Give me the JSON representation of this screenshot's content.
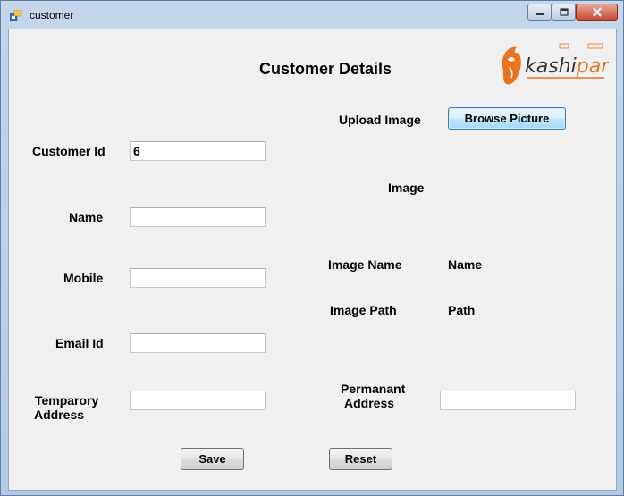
{
  "window": {
    "title": "customer",
    "icon": "form-icon",
    "controls": [
      "minimize-icon",
      "maximize-icon",
      "close-icon"
    ]
  },
  "logo": {
    "text": "kashipara"
  },
  "form": {
    "heading": "Customer Details",
    "customer_id": {
      "label": "Customer Id",
      "value": "6"
    },
    "name": {
      "label": "Name",
      "value": ""
    },
    "mobile": {
      "label": "Mobile",
      "value": ""
    },
    "email": {
      "label": "Email Id",
      "value": ""
    },
    "temporary_address": {
      "label_line1": "Temparory",
      "label_line2": "Address",
      "value": ""
    },
    "permanent_address": {
      "label_line1": "Permanant",
      "label_line2": "Address",
      "value": ""
    },
    "upload_image_label": "Upload Image",
    "browse_button": "Browse Picture",
    "image_label": "Image",
    "image_name_label": "Image Name",
    "image_name_value": "Name",
    "image_path_label": "Image Path",
    "image_path_value": "Path",
    "save_button": "Save",
    "reset_button": "Reset"
  },
  "colors": {
    "logo_orange": "#e8741e",
    "logo_dark": "#333333"
  }
}
